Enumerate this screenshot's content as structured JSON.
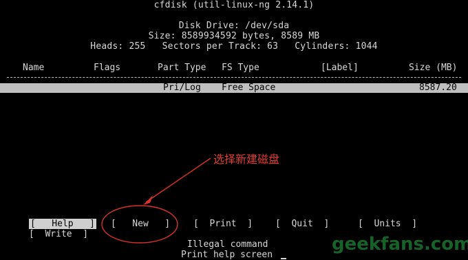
{
  "header": {
    "title": "cfdisk (util-linux-ng 2.14.1)",
    "disk_drive": "Disk Drive: /dev/sda",
    "size": "Size: 8589934592 bytes, 8589 MB",
    "geometry": "Heads: 255   Sectors per Track: 63   Cylinders: 1044"
  },
  "table": {
    "columns": [
      "Name",
      "Flags",
      "Part Type",
      "FS Type",
      "[Label]",
      "Size (MB)"
    ],
    "rows": [
      {
        "name": "",
        "flags": "",
        "part_type": "Pri/Log",
        "fs_type": "Free Space",
        "label": "",
        "size": "8587.20",
        "selected": true
      }
    ]
  },
  "menu": {
    "items": [
      {
        "label": "[   Help   ]",
        "active": true
      },
      {
        "label": "[   New   ]",
        "active": false
      },
      {
        "label": "[  Print  ]",
        "active": false
      },
      {
        "label": "[  Quit  ]",
        "active": false
      },
      {
        "label": "[  Units  ]",
        "active": false
      },
      {
        "label": "[  Write  ]",
        "active": false
      }
    ]
  },
  "status": {
    "message": "Illegal command",
    "help": "Print help screen"
  },
  "annotation": {
    "text": "选择新建磁盘",
    "color": "#e23a2f"
  },
  "watermark": {
    "text": "geekfans.com",
    "color": "#2bb24c"
  }
}
